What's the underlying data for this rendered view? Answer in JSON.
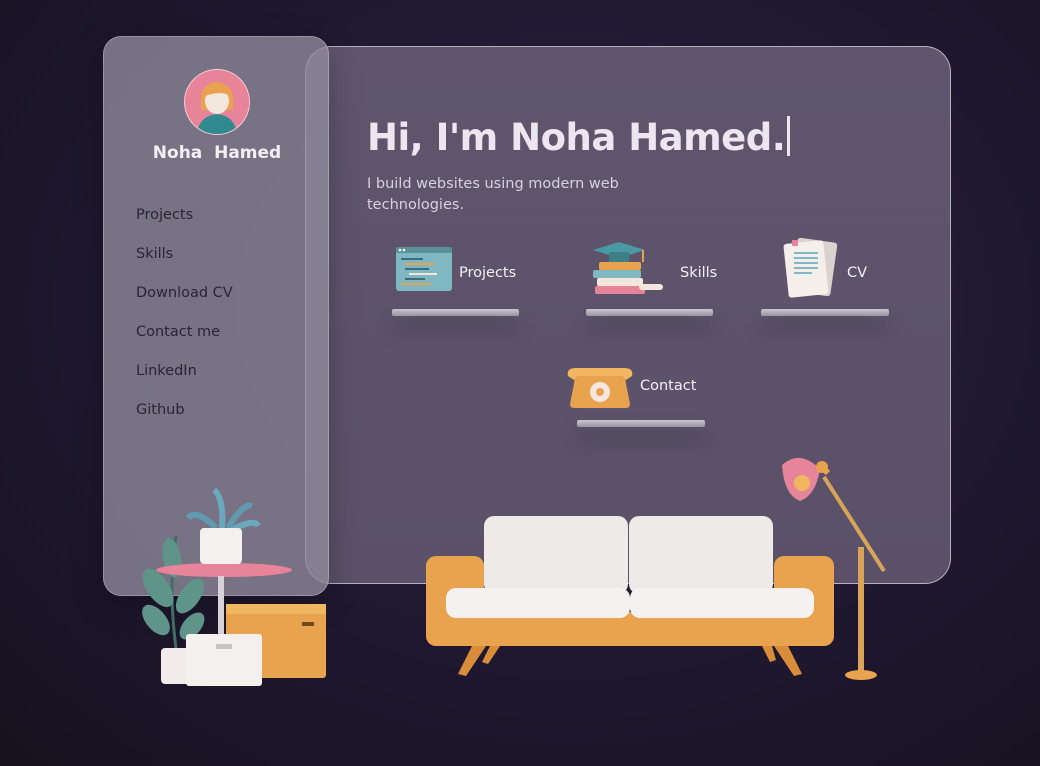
{
  "profile": {
    "name": "Noha  Hamed",
    "avatar_icon": "avatar-illustration"
  },
  "nav": {
    "items": [
      {
        "label": "Projects"
      },
      {
        "label": "Skills"
      },
      {
        "label": "Download CV"
      },
      {
        "label": "Contact me"
      },
      {
        "label": "LinkedIn"
      },
      {
        "label": "Github"
      }
    ]
  },
  "hero": {
    "title": "Hi, I'm Noha Hamed.",
    "subtitle": "I build websites using modern web technologies."
  },
  "shelves": {
    "projects": {
      "label": "Projects",
      "icon": "code-window-icon"
    },
    "skills": {
      "label": "Skills",
      "icon": "graduation-books-icon"
    },
    "cv": {
      "label": "CV",
      "icon": "document-pages-icon"
    },
    "contact": {
      "label": "Contact",
      "icon": "telephone-icon"
    }
  },
  "colors": {
    "background": "#1f1830",
    "card": "#5c5369",
    "sidebar": "#918c9c",
    "accent_orange": "#e9a24e",
    "accent_pink": "#e8849a"
  }
}
